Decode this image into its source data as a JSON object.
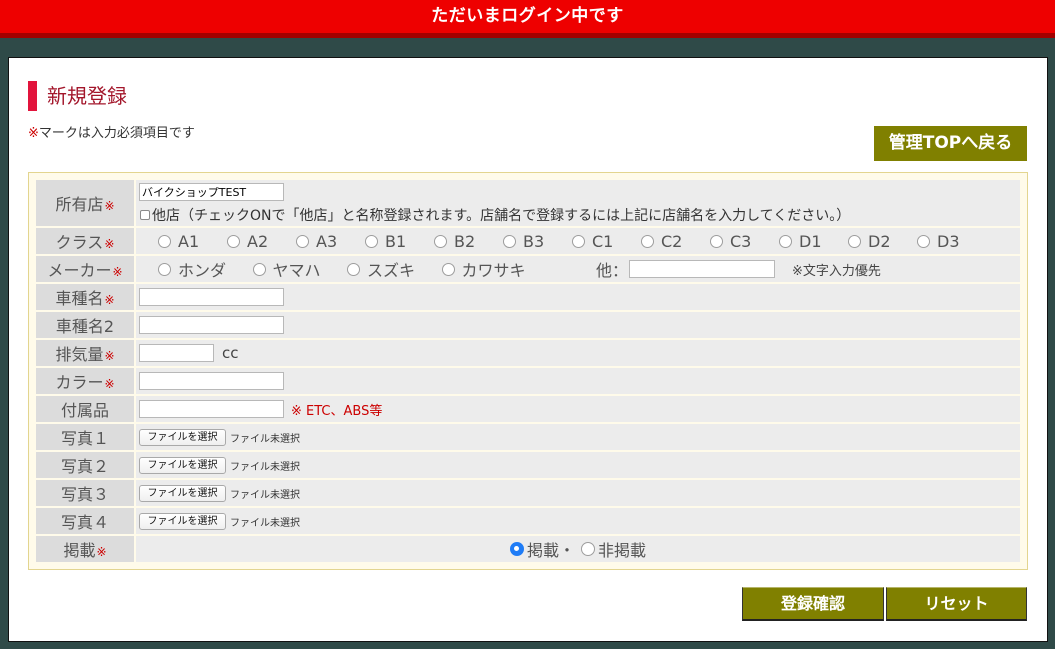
{
  "colors": {
    "banner": "#ee0000",
    "background": "#2f4a48",
    "accent": "#e2143c",
    "button": "#808000",
    "required": "#cc0000"
  },
  "banner": {
    "text": "ただいまログイン中です"
  },
  "header": {
    "title": "新規登録",
    "required_note": {
      "mark": "※",
      "text": "マークは入力必須項目です"
    },
    "back_button": "管理TOPへ戻る"
  },
  "form": {
    "required_mark": "※",
    "shop": {
      "label": "所有店",
      "value": "バイクショップTEST",
      "other_checkbox": {
        "checked": false,
        "label": "他店（チェックONで「他店」と名称登録されます。店舗名で登録するには上記に店舗名を入力してください。）"
      }
    },
    "class": {
      "label": "クラス",
      "options": [
        "A1",
        "A2",
        "A3",
        "B1",
        "B2",
        "B3",
        "C1",
        "C2",
        "C3",
        "D1",
        "D2",
        "D3"
      ]
    },
    "maker": {
      "label": "メーカー",
      "options": [
        "ホンダ",
        "ヤマハ",
        "スズキ",
        "カワサキ"
      ],
      "other_label": "他：",
      "other_value": "",
      "note": "※文字入力優先"
    },
    "model": {
      "label": "車種名",
      "value": ""
    },
    "model2": {
      "label": "車種名2",
      "value": ""
    },
    "displacement": {
      "label": "排気量",
      "value": "",
      "unit": "cc"
    },
    "color": {
      "label": "カラー",
      "value": ""
    },
    "accessories": {
      "label": "付属品",
      "value": "",
      "hint": "※ ETC、ABS等"
    },
    "photos": [
      {
        "label": "写真１",
        "button": "ファイルを選択",
        "status": "ファイル未選択"
      },
      {
        "label": "写真２",
        "button": "ファイルを選択",
        "status": "ファイル未選択"
      },
      {
        "label": "写真３",
        "button": "ファイルを選択",
        "status": "ファイル未選択"
      },
      {
        "label": "写真４",
        "button": "ファイルを選択",
        "status": "ファイル未選択"
      }
    ],
    "publish": {
      "label": "掲載",
      "options": [
        "掲載・",
        "非掲載"
      ],
      "selected": 0
    }
  },
  "actions": {
    "confirm": "登録確認",
    "reset": "リセット"
  }
}
